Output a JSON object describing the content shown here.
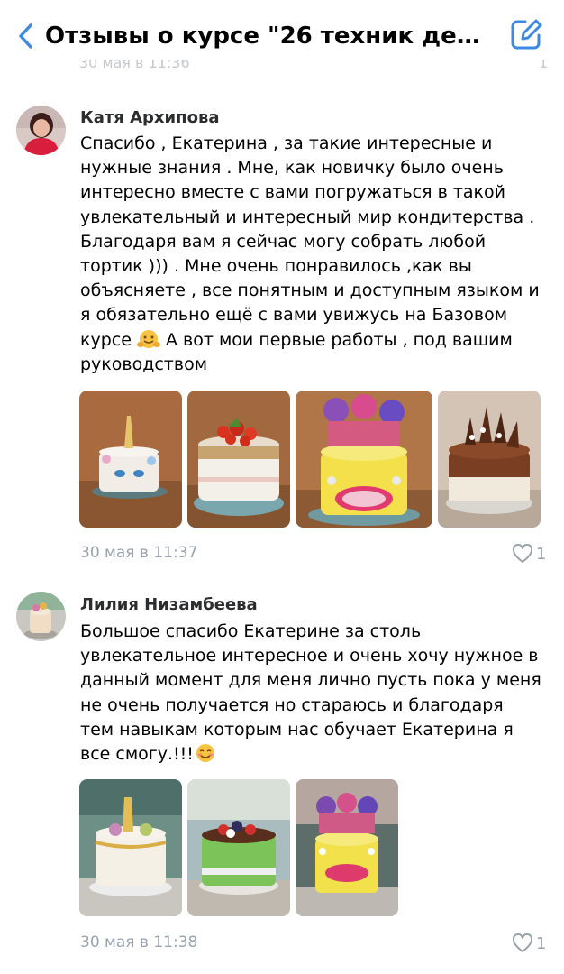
{
  "header": {
    "title": "Отзывы о курсе \"26 техник дек...",
    "back_icon": "chevron-left-icon",
    "compose_icon": "compose-icon",
    "accent_color": "#3f8ae0"
  },
  "ghost": {
    "date": "30 мая в 11:36",
    "likes": "1"
  },
  "comments": [
    {
      "author": "Катя Архипова",
      "text_lines": [
        "Спасибо , Екатерина , за такие интересные и",
        "нужные знания . Мне,  как новичку было очень",
        "интересно вместе с вами погружаться в такой",
        "увлекательный и интересный мир кондитерства  .",
        "Благодаря вам я сейчас могу собрать любой",
        "тортик ))) . Мне очень понравилось ,как вы",
        "объясняете , все понятным и доступным языком и",
        "я обязательно ещё с вами увижусь на  Базовом"
      ],
      "line9_before": "курсе ",
      "line9_after": " А вот мои первые работы , под вашим",
      "line10": "руководством",
      "date": "30 мая в 11:37",
      "likes": "1"
    },
    {
      "author": "Лилия Низамбеева",
      "text_lines": [
        "Большое спасибо Екатерине за столь",
        "увлекательное интересное и очень хочу нужное в",
        "данный момент для меня лично пусть пока у меня",
        "не очень получается но стараюсь и благодаря",
        "тем навыкам которым нас обучает Екатерина я"
      ],
      "line6_before": "все смогу.!!!",
      "date": "30 мая в 11:38",
      "likes": "1"
    }
  ]
}
